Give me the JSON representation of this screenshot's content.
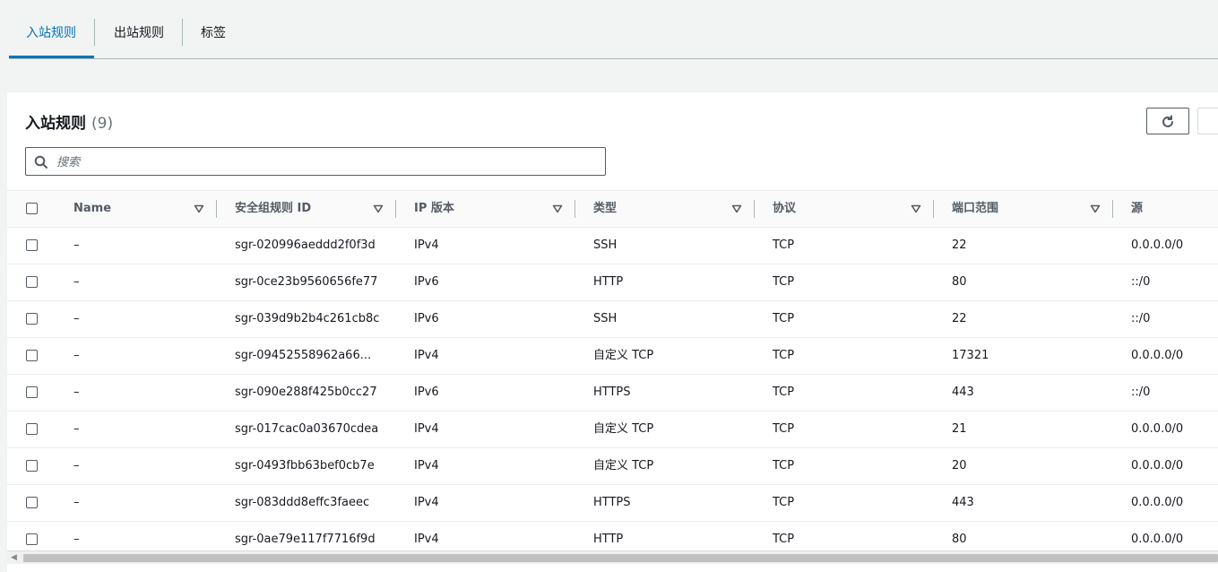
{
  "tabs": [
    {
      "label": "入站规则",
      "active": true
    },
    {
      "label": "出站规则",
      "active": false
    },
    {
      "label": "标签",
      "active": false
    }
  ],
  "panel": {
    "title": "入站规则",
    "count": "(9)",
    "search_placeholder": "搜索"
  },
  "columns": [
    "Name",
    "安全组规则 ID",
    "IP 版本",
    "类型",
    "协议",
    "端口范围",
    "源"
  ],
  "rows": [
    {
      "name": "–",
      "id": "sgr-020996aeddd2f0f3d",
      "ip": "IPv4",
      "type": "SSH",
      "proto": "TCP",
      "port": "22",
      "src": "0.0.0.0/0"
    },
    {
      "name": "–",
      "id": "sgr-0ce23b9560656fe77",
      "ip": "IPv6",
      "type": "HTTP",
      "proto": "TCP",
      "port": "80",
      "src": "::/0"
    },
    {
      "name": "–",
      "id": "sgr-039d9b2b4c261cb8c",
      "ip": "IPv6",
      "type": "SSH",
      "proto": "TCP",
      "port": "22",
      "src": "::/0"
    },
    {
      "name": "–",
      "id": "sgr-09452558962a66...",
      "ip": "IPv4",
      "type": "自定义 TCP",
      "proto": "TCP",
      "port": "17321",
      "src": "0.0.0.0/0"
    },
    {
      "name": "–",
      "id": "sgr-090e288f425b0cc27",
      "ip": "IPv6",
      "type": "HTTPS",
      "proto": "TCP",
      "port": "443",
      "src": "::/0"
    },
    {
      "name": "–",
      "id": "sgr-017cac0a03670cdea",
      "ip": "IPv4",
      "type": "自定义 TCP",
      "proto": "TCP",
      "port": "21",
      "src": "0.0.0.0/0"
    },
    {
      "name": "–",
      "id": "sgr-0493fbb63bef0cb7e",
      "ip": "IPv4",
      "type": "自定义 TCP",
      "proto": "TCP",
      "port": "20",
      "src": "0.0.0.0/0"
    },
    {
      "name": "–",
      "id": "sgr-083ddd8effc3faeec",
      "ip": "IPv4",
      "type": "HTTPS",
      "proto": "TCP",
      "port": "443",
      "src": "0.0.0.0/0"
    },
    {
      "name": "–",
      "id": "sgr-0ae79e117f7716f9d",
      "ip": "IPv4",
      "type": "HTTP",
      "proto": "TCP",
      "port": "80",
      "src": "0.0.0.0/0"
    }
  ],
  "colors": {
    "accent": "#0073bb",
    "text": "#16191f",
    "muted": "#545b64"
  },
  "icons": {
    "refresh": "refresh-icon",
    "search": "search-icon",
    "sort": "sort-caret-icon"
  }
}
